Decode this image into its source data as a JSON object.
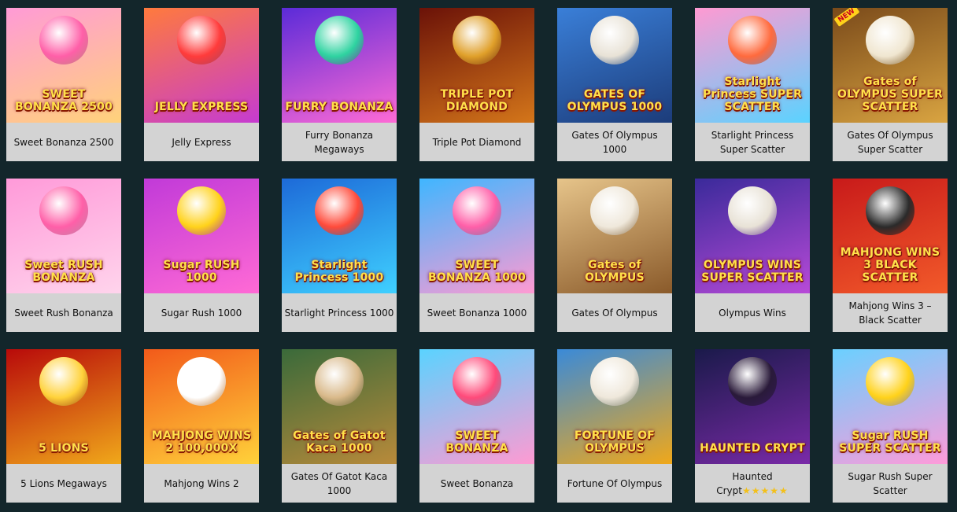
{
  "games": [
    {
      "title": "Sweet Bonanza 2500",
      "logo": "SWEET BONANZA 2500",
      "bg": [
        "#ff9bd6",
        "#ffd27a"
      ],
      "art": "#ff5fa8"
    },
    {
      "title": "Jelly Express",
      "logo": "JELLY EXPRESS",
      "bg": [
        "#ff7a3d",
        "#c63bd1"
      ],
      "art": "#ff3b3b"
    },
    {
      "title": "Furry Bonanza Megaways",
      "logo": "FURRY BONANZA",
      "bg": [
        "#5b2bd8",
        "#ff6ad5"
      ],
      "art": "#2ed3a0"
    },
    {
      "title": "Triple Pot Diamond",
      "logo": "TRIPLE POT DIAMOND",
      "bg": [
        "#6b1208",
        "#d4761a"
      ],
      "art": "#e0a02a"
    },
    {
      "title": "Gates Of Olympus 1000",
      "logo": "GATES OF OLYMPUS 1000",
      "bg": [
        "#3a7fd8",
        "#1c3c7a"
      ],
      "art": "#e8e2d6"
    },
    {
      "title": "Starlight Princess Super Scatter",
      "logo": "Starlight Princess SUPER SCATTER",
      "bg": [
        "#ff9ad2",
        "#5ad3ff"
      ],
      "art": "#ff6a3d"
    },
    {
      "title": "Gates Of Olympus Super Scatter",
      "logo": "Gates of OLYMPUS SUPER SCATTER",
      "bg": [
        "#7a4a1a",
        "#d9a441"
      ],
      "art": "#f0e6d0",
      "badge": "NEW"
    },
    {
      "title": "Sweet Rush Bonanza",
      "logo": "Sweet RUSH BONANZA",
      "bg": [
        "#ff9ad9",
        "#ffd4ec"
      ],
      "art": "#ff5fa8"
    },
    {
      "title": "Sugar Rush 1000",
      "logo": "Sugar RUSH 1000",
      "bg": [
        "#c13ad8",
        "#ff6ad5"
      ],
      "art": "#ffd21a"
    },
    {
      "title": "Starlight Princess 1000",
      "logo": "Starlight Princess 1000",
      "bg": [
        "#1d6ad8",
        "#3fd0ff"
      ],
      "art": "#ff4a3a"
    },
    {
      "title": "Sweet Bonanza 1000",
      "logo": "SWEET BONANZA 1000",
      "bg": [
        "#3fb6ff",
        "#ff9ad2"
      ],
      "art": "#ff5fa8"
    },
    {
      "title": "Gates Of Olympus",
      "logo": "Gates of OLYMPUS",
      "bg": [
        "#e6c48a",
        "#8a5a2a"
      ],
      "art": "#efe8db"
    },
    {
      "title": "Olympus Wins",
      "logo": "OLYMPUS WINS SUPER SCATTER",
      "bg": [
        "#3a2a9a",
        "#b84ad8"
      ],
      "art": "#e8e2d6"
    },
    {
      "title": "Mahjong Wins 3 – Black Scatter",
      "logo": "MAHJONG WINS 3 BLACK SCATTER",
      "bg": [
        "#c81a1a",
        "#f25a2a"
      ],
      "art": "#2a2a2a"
    },
    {
      "title": "5 Lions Megaways",
      "logo": "5 LIONS",
      "bg": [
        "#b80a0a",
        "#f0a81a"
      ],
      "art": "#ffd23a"
    },
    {
      "title": "Mahjong Wins 2",
      "logo": "MAHJONG WINS 2 100,000X",
      "bg": [
        "#f25a1a",
        "#ffd23a"
      ],
      "art": "#ffffff"
    },
    {
      "title": "Gates Of Gatot Kaca 1000",
      "logo": "Gates of Gatot Kaca 1000",
      "bg": [
        "#3a6a3a",
        "#b88a3a"
      ],
      "art": "#d9b98a"
    },
    {
      "title": "Sweet Bonanza",
      "logo": "SWEET BONANZA",
      "bg": [
        "#5ad3ff",
        "#ff9ad2"
      ],
      "art": "#ff4a7a"
    },
    {
      "title": "Fortune Of Olympus",
      "logo": "FORTUNE OF OLYMPUS",
      "bg": [
        "#3a8ad8",
        "#f0a81a"
      ],
      "art": "#efe8db"
    },
    {
      "title": "Haunted Crypt",
      "logo": "HAUNTED CRYPT",
      "bg": [
        "#1a1a4a",
        "#7a2aa8"
      ],
      "art": "#2a1a3a",
      "stars": "★★★★★"
    },
    {
      "title": "Sugar Rush Super Scatter",
      "logo": "Sugar RUSH SUPER SCATTER",
      "bg": [
        "#6ad0ff",
        "#ff9ad9"
      ],
      "art": "#ffd21a"
    }
  ]
}
